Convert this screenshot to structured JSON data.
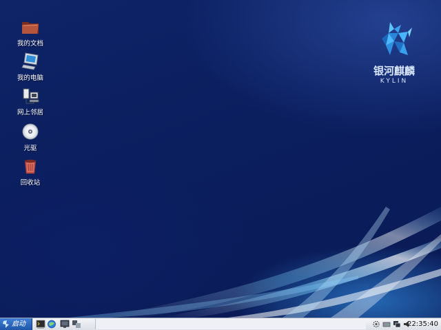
{
  "desktop": {
    "icons": [
      {
        "label": "我的文档",
        "icon": "folder-icon"
      },
      {
        "label": "我的电脑",
        "icon": "computer-icon"
      },
      {
        "label": "网上邻居",
        "icon": "network-icon"
      },
      {
        "label": "光驱",
        "icon": "cdrom-icon"
      },
      {
        "label": "回收站",
        "icon": "trash-icon"
      }
    ],
    "logo": {
      "cn": "银河麒麟",
      "en": "KYLIN"
    }
  },
  "taskbar": {
    "start_label": "启动",
    "quick_launch": [
      "terminal-icon",
      "browser-icon",
      "monitor-icon",
      "show-desktop-icon"
    ],
    "tray": [
      "settings-icon",
      "drive-icon",
      "network-status-icon",
      "volume-icon"
    ],
    "clock": "22:35:40"
  },
  "colors": {
    "desktop_bg": "#0b1e5e",
    "taskbar_bg": "#e6e8ee",
    "start_bg": "#2a66bd"
  }
}
